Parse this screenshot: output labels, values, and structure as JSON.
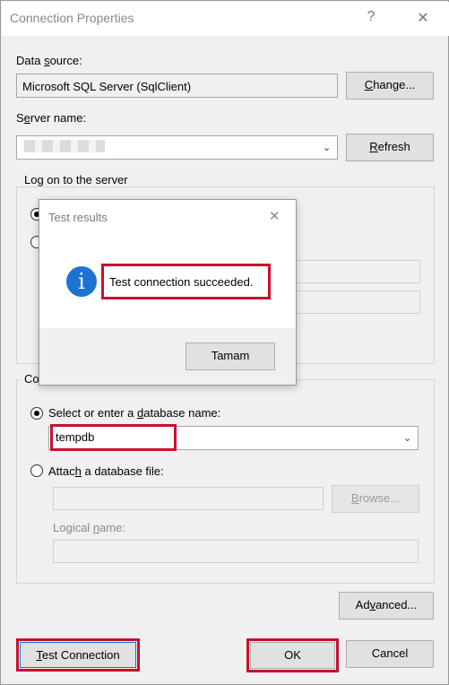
{
  "window": {
    "title": "Connection Properties",
    "help_glyph": "?",
    "close_glyph": "✕"
  },
  "data_source": {
    "label": "Data source:",
    "value": "Microsoft SQL Server (SqlClient)",
    "change_button": "Change..."
  },
  "server": {
    "label": "Server name:",
    "value": "",
    "refresh_button": "Refresh"
  },
  "logon": {
    "group_label": "Log on to the server"
  },
  "database": {
    "group_label": "Co",
    "select_label": "Select or enter a database name:",
    "selected_db": "tempdb",
    "attach_label": "Attach a database file:",
    "browse_button": "Browse...",
    "logical_name_label": "Logical name:"
  },
  "buttons": {
    "advanced": "Advanced...",
    "test_connection": "Test Connection",
    "ok": "OK",
    "cancel": "Cancel"
  },
  "modal": {
    "title": "Test results",
    "close_glyph": "✕",
    "message": "Test connection succeeded.",
    "ok_button": "Tamam",
    "icon_glyph": "i"
  },
  "colors": {
    "highlight_red": "#c8102e",
    "info_blue": "#1c74d0"
  }
}
